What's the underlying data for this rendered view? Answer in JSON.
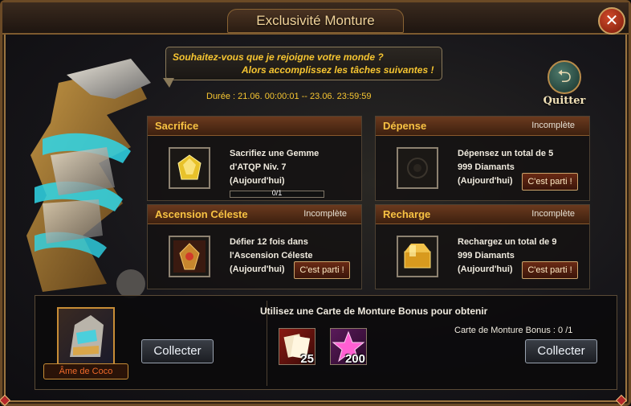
{
  "window": {
    "title": "Exclusivité Monture",
    "close_icon": "close-icon"
  },
  "intro": {
    "line1": "Souhaitez-vous que je rejoigne votre monde ?",
    "line2": "Alors accomplissez les tâches suivantes !",
    "duration": "Durée : 21.06. 00:00:01 -- 23.06. 23:59:59"
  },
  "quit": {
    "label": "Quitter",
    "icon": "return-arrow-icon"
  },
  "tasks": [
    {
      "name": "Sacrifice",
      "status": "",
      "line1": "Sacrifiez une Gemme",
      "line2": "d'ATQP Niv. 7",
      "line3": "(Aujourd'hui)",
      "progress_label": "0/1",
      "progress": 0,
      "icon": "gem-icon",
      "button": ""
    },
    {
      "name": "Dépense",
      "status": "Incomplète",
      "line1": "Dépensez un total de 5",
      "line2": "999 Diamants",
      "line3": "(Aujourd'hui)",
      "icon": "empty-slot-icon",
      "button": "C'est parti !"
    },
    {
      "name": "Ascension Céleste",
      "status": "Incomplète",
      "line1": "Défier 12 fois dans",
      "line2": "l'Ascension Céleste",
      "line3": "(Aujourd'hui)",
      "icon": "crest-icon",
      "button": "C'est parti !"
    },
    {
      "name": "Recharge",
      "status": "Incomplète",
      "line1": "Rechargez un total de 9",
      "line2": "999 Diamants",
      "line3": "(Aujourd'hui)",
      "icon": "gold-chest-icon",
      "button": "C'est parti !"
    }
  ],
  "reward": {
    "portrait_label": "Âme de Coco",
    "collect_label": "Collecter",
    "bonus_title": "Utilisez une Carte de Monture Bonus pour obtenir",
    "bonus_count": "Carte de Monture Bonus : 0 /1",
    "items": [
      {
        "icon": "card-icon",
        "count": "25"
      },
      {
        "icon": "star-icon",
        "count": "200"
      }
    ],
    "collect_label_2": "Collecter"
  },
  "colors": {
    "accent_gold": "#f6c531",
    "header_orange": "#f8c243",
    "portrait_label": "#f06a2a"
  }
}
